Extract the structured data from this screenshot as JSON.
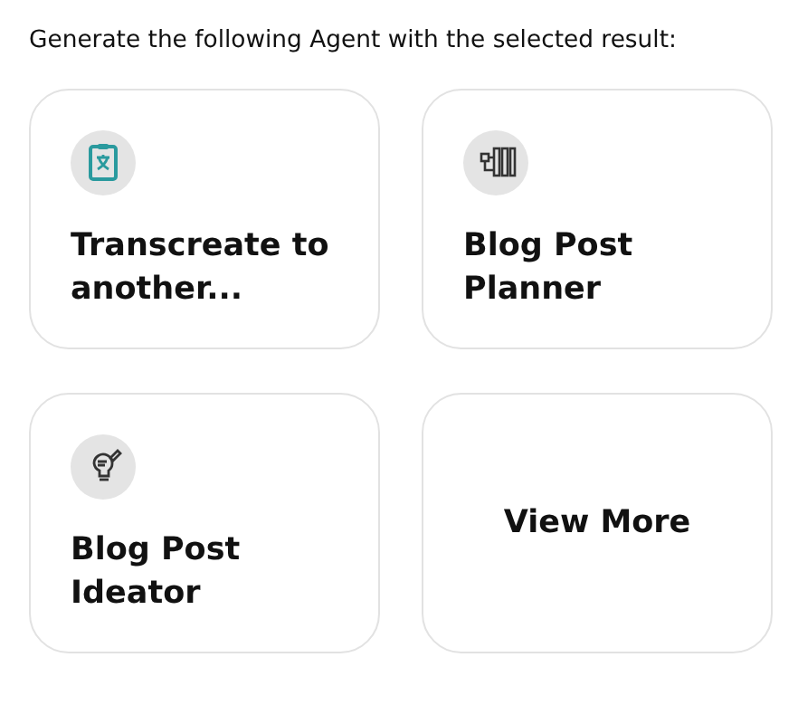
{
  "prompt": "Generate the following Agent with the selected result:",
  "cards": [
    {
      "kind": "agent",
      "title": "Transcreate to another..."
    },
    {
      "kind": "agent",
      "title": "Blog Post Planner"
    },
    {
      "kind": "agent",
      "title": "Blog Post Ideator"
    },
    {
      "kind": "more",
      "title": "View More"
    }
  ]
}
